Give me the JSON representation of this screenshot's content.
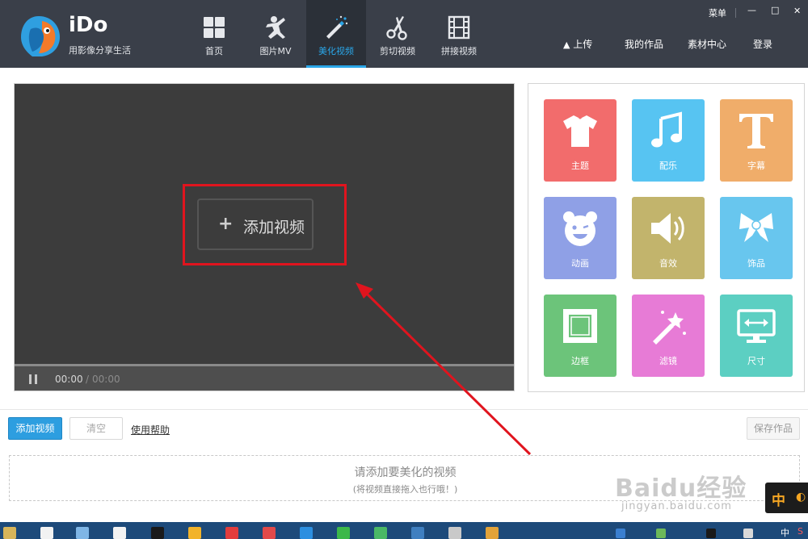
{
  "app": {
    "name": "iDo",
    "slogan": "用影像分享生活"
  },
  "nav": {
    "items": [
      {
        "label": "首页",
        "icon": "grid-icon"
      },
      {
        "label": "图片MV",
        "icon": "photo-mv-icon"
      },
      {
        "label": "美化视频",
        "icon": "magic-wand-icon",
        "active": true
      },
      {
        "label": "剪切视频",
        "icon": "scissors-icon"
      },
      {
        "label": "拼接视频",
        "icon": "film-strip-icon"
      }
    ]
  },
  "window": {
    "menu_label": "菜单",
    "minimize_glyph": "—",
    "maximize_glyph": "□",
    "close_glyph": "✕"
  },
  "top_links": {
    "upload": "上传",
    "my_works": "我的作品",
    "materials": "素材中心",
    "login": "登录"
  },
  "player": {
    "add_video_label": "添加视频",
    "plus_glyph": "+",
    "time_current": "00:00",
    "time_separator": "/",
    "time_total": "00:00"
  },
  "tools": [
    {
      "label": "主题",
      "icon": "tshirt-icon",
      "color": "#f26c6c"
    },
    {
      "label": "配乐",
      "icon": "music-note-icon",
      "color": "#57c4f2"
    },
    {
      "label": "字幕",
      "icon": "text-t-icon",
      "color": "#f0ad6a"
    },
    {
      "label": "动画",
      "icon": "bear-face-icon",
      "color": "#8fa0e6"
    },
    {
      "label": "音效",
      "icon": "speaker-icon",
      "color": "#c2b46c"
    },
    {
      "label": "饰品",
      "icon": "bow-icon",
      "color": "#68c6ee"
    },
    {
      "label": "边框",
      "icon": "stamp-frame-icon",
      "color": "#6cc47a"
    },
    {
      "label": "滤镜",
      "icon": "magic-wand-icon",
      "color": "#e77bd6"
    },
    {
      "label": "尺寸",
      "icon": "monitor-resize-icon",
      "color": "#5ccfc2"
    }
  ],
  "toolbar": {
    "add_video": "添加视频",
    "clear": "清空",
    "help": "使用帮助",
    "save": "保存作品"
  },
  "dropzone": {
    "main_text": "请添加要美化的视频",
    "sub_text": "(将视频直接拖入也行哦！)"
  },
  "watermark": {
    "brand": "Baidu经验",
    "url": "jingyan.baidu.com"
  },
  "ime": {
    "char": "中"
  },
  "taskbar": {
    "tray_lang": "中",
    "tray_s": "S"
  },
  "colors": {
    "header_bg": "#3a3f49",
    "accent": "#2aa6e8",
    "annotation_red": "#e0141e",
    "player_bg": "#3c3c3c"
  }
}
